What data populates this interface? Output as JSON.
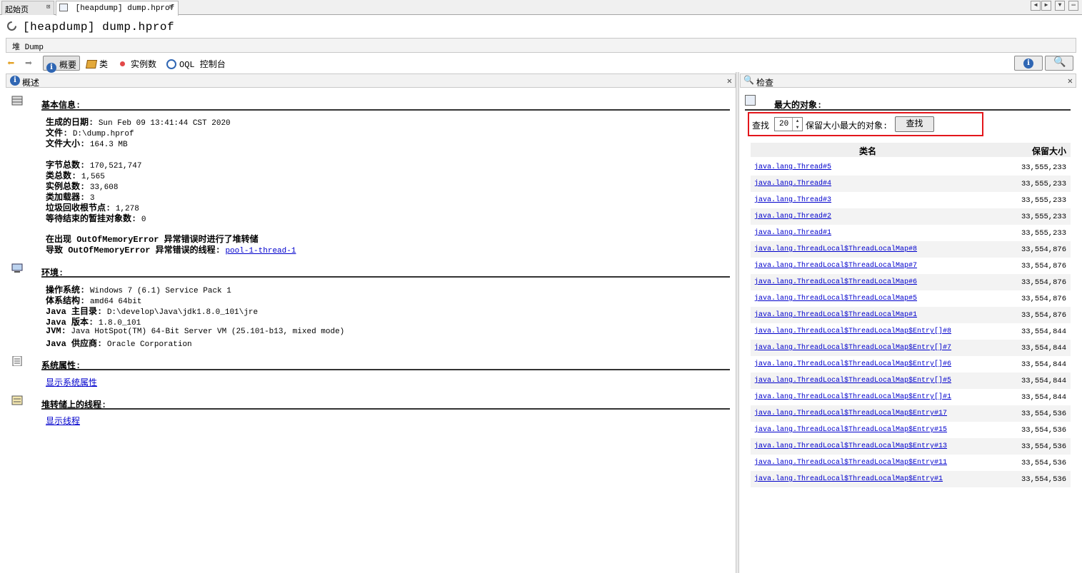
{
  "tabs": [
    {
      "label": "起始页"
    },
    {
      "label": "[heapdump] dump.hprof"
    }
  ],
  "window_title": "[heapdump] dump.hprof",
  "heap_bar": {
    "label": "堆 Dump"
  },
  "toolbar": {
    "summary": "概要",
    "classes": "类",
    "instances": "实例数",
    "oql": "OQL 控制台"
  },
  "left_pane": {
    "title": "概述",
    "basic": {
      "heading": "基本信息:",
      "rows": [
        {
          "label": "生成的日期:",
          "value": "Sun Feb 09 13:41:44 CST 2020"
        },
        {
          "label": "文件:",
          "value": "D:\\dump.hprof"
        },
        {
          "label": "文件大小:",
          "value": "164.3 MB"
        },
        {
          "label": "字节总数:",
          "value": "170,521,747"
        },
        {
          "label": "类总数:",
          "value": "1,565"
        },
        {
          "label": "实例总数:",
          "value": "33,608"
        },
        {
          "label": "类加载器:",
          "value": "3"
        },
        {
          "label": "垃圾回收根节点:",
          "value": "1,278"
        },
        {
          "label": "等待结束的暂挂对象数:",
          "value": "0"
        }
      ],
      "oom_line1": "在出现 OutOfMemoryError 异常错误时进行了堆转储",
      "oom_line2_label": "导致 OutOfMemoryError 异常错误的线程:",
      "oom_line2_link": "pool-1-thread-1"
    },
    "env": {
      "heading": "环境:",
      "rows": [
        {
          "label": "操作系统:",
          "value": "Windows 7 (6.1) Service Pack 1"
        },
        {
          "label": "体系结构:",
          "value": "amd64 64bit"
        },
        {
          "label": "Java 主目录:",
          "value": "D:\\develop\\Java\\jdk1.8.0_101\\jre"
        },
        {
          "label": "Java 版本:",
          "value": "1.8.0_101"
        },
        {
          "label": "JVM:",
          "value": "Java HotSpot(TM) 64-Bit Server VM (25.101-b13, mixed mode)"
        },
        {
          "label": "Java 供应商:",
          "value": "Oracle Corporation"
        }
      ]
    },
    "sysprops": {
      "heading": "系统属性:",
      "link": "显示系统属性"
    },
    "threads": {
      "heading": "堆转储上的线程:",
      "link": "显示线程"
    }
  },
  "right_pane": {
    "title": "检查",
    "heading": "最大的对象:",
    "find_label": "查找",
    "find_count": "20",
    "find_suffix": "保留大小最大的对象:",
    "find_button": "查找",
    "col_name": "类名",
    "col_size": "保留大小",
    "rows": [
      {
        "name": "java.lang.Thread#5",
        "size": "33,555,233"
      },
      {
        "name": "java.lang.Thread#4",
        "size": "33,555,233"
      },
      {
        "name": "java.lang.Thread#3",
        "size": "33,555,233"
      },
      {
        "name": "java.lang.Thread#2",
        "size": "33,555,233"
      },
      {
        "name": "java.lang.Thread#1",
        "size": "33,555,233"
      },
      {
        "name": "java.lang.ThreadLocal$ThreadLocalMap#8",
        "size": "33,554,876"
      },
      {
        "name": "java.lang.ThreadLocal$ThreadLocalMap#7",
        "size": "33,554,876"
      },
      {
        "name": "java.lang.ThreadLocal$ThreadLocalMap#6",
        "size": "33,554,876"
      },
      {
        "name": "java.lang.ThreadLocal$ThreadLocalMap#5",
        "size": "33,554,876"
      },
      {
        "name": "java.lang.ThreadLocal$ThreadLocalMap#1",
        "size": "33,554,876"
      },
      {
        "name": "java.lang.ThreadLocal$ThreadLocalMap$Entry[]#8",
        "size": "33,554,844"
      },
      {
        "name": "java.lang.ThreadLocal$ThreadLocalMap$Entry[]#7",
        "size": "33,554,844"
      },
      {
        "name": "java.lang.ThreadLocal$ThreadLocalMap$Entry[]#6",
        "size": "33,554,844"
      },
      {
        "name": "java.lang.ThreadLocal$ThreadLocalMap$Entry[]#5",
        "size": "33,554,844"
      },
      {
        "name": "java.lang.ThreadLocal$ThreadLocalMap$Entry[]#1",
        "size": "33,554,844"
      },
      {
        "name": "java.lang.ThreadLocal$ThreadLocalMap$Entry#17",
        "size": "33,554,536"
      },
      {
        "name": "java.lang.ThreadLocal$ThreadLocalMap$Entry#15",
        "size": "33,554,536"
      },
      {
        "name": "java.lang.ThreadLocal$ThreadLocalMap$Entry#13",
        "size": "33,554,536"
      },
      {
        "name": "java.lang.ThreadLocal$ThreadLocalMap$Entry#11",
        "size": "33,554,536"
      },
      {
        "name": "java.lang.ThreadLocal$ThreadLocalMap$Entry#1",
        "size": "33,554,536"
      }
    ]
  },
  "colors": {
    "link": "#0000cc",
    "highlight_box": "#e3161b",
    "info_icon": "#2f66b3"
  }
}
